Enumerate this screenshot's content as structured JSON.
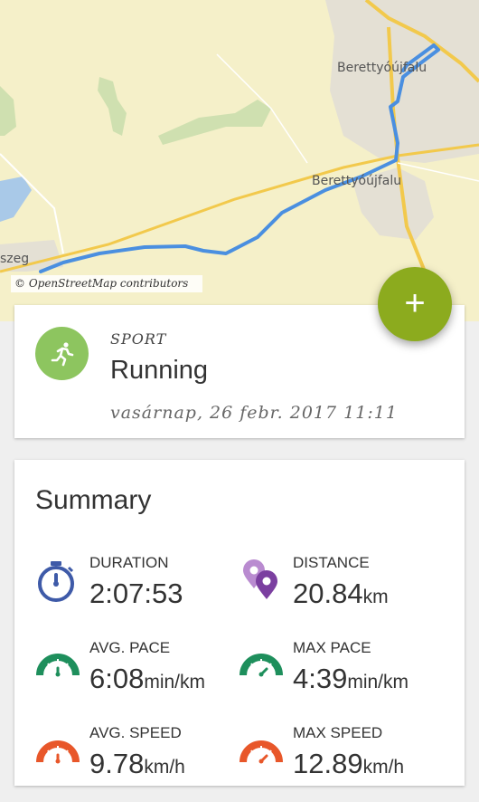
{
  "map": {
    "town_top": "Berettyóújfalu",
    "town_mid": "Berettyóújfalu",
    "town_left": "szeg",
    "attribution": "© OpenStreetMap contributors",
    "route_color": "#4a8fe0",
    "road_color": "#f2c94c"
  },
  "fab": {
    "label": "+",
    "color": "#8cab1e"
  },
  "sport": {
    "section_label": "SPORT",
    "name": "Running",
    "date": "vasárnap, 26 febr. 2017 11:11",
    "icon": "running-person-icon"
  },
  "summary": {
    "title": "Summary",
    "metrics": [
      {
        "label": "DURATION",
        "value": "2:07:53",
        "unit": "",
        "icon": "stopwatch-icon",
        "color": "#3e5aa8"
      },
      {
        "label": "DISTANCE",
        "value": "20.84",
        "unit": "km",
        "icon": "map-pins-icon",
        "color": "#7b3fa0"
      },
      {
        "label": "AVG. PACE",
        "value": "6:08",
        "unit": "min/km",
        "icon": "gauge-icon",
        "color": "#1e8f5c"
      },
      {
        "label": "MAX PACE",
        "value": "4:39",
        "unit": "min/km",
        "icon": "gauge-icon",
        "color": "#1e8f5c"
      },
      {
        "label": "AVG. SPEED",
        "value": "9.78",
        "unit": "km/h",
        "icon": "speedometer-icon",
        "color": "#e8572a"
      },
      {
        "label": "MAX SPEED",
        "value": "12.89",
        "unit": "km/h",
        "icon": "speedometer-icon",
        "color": "#e8572a"
      }
    ]
  }
}
